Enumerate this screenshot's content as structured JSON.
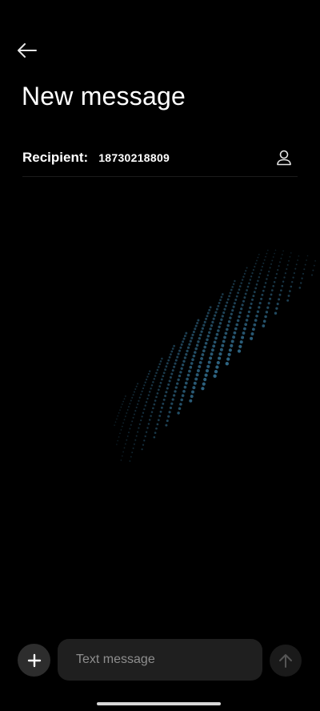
{
  "header": {
    "title": "New message",
    "back_icon": "arrow-left-icon"
  },
  "recipient": {
    "label": "Recipient:",
    "value": "18730218809",
    "contact_icon": "person-icon"
  },
  "composer": {
    "placeholder": "Text message",
    "add_icon": "plus-icon",
    "send_icon": "arrow-up-icon"
  },
  "colors": {
    "background": "#000000",
    "dot_accent": "#4aa3d4",
    "input_bg": "#1f1f1f"
  }
}
